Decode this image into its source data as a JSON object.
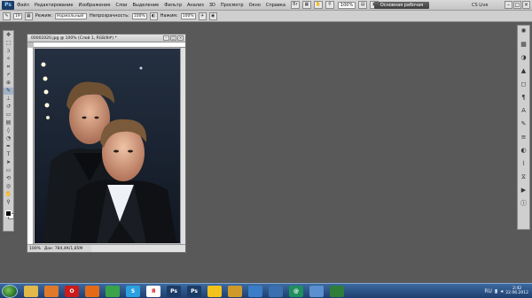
{
  "menubar": {
    "items": [
      "Файл",
      "Редактирование",
      "Изображение",
      "Слои",
      "Выделение",
      "Фильтр",
      "Анализ",
      "3D",
      "Просмотр",
      "Окно",
      "Справка"
    ],
    "zoom": "100%",
    "workspace_label": "Основная рабочая среда",
    "cslive_label": "CS Live"
  },
  "options_bar": {
    "brush_size": "19",
    "mode_label": "Режим:",
    "mode_value": "Нормальный",
    "opacity_label": "Непрозрачность:",
    "opacity_value": "100%",
    "flow_label": "Нажим:",
    "flow_value": "100%"
  },
  "document": {
    "title": "00002020.jpg @ 100% (Слой 1, RGB/8#) *",
    "zoom_status": "100%",
    "doc_size": "Док: 784,4К/1,85М",
    "image_icon": "photo-two-men"
  },
  "taskbar": {
    "apps": [
      {
        "icon": "folder-icon",
        "color": "#e1b84a",
        "label": ""
      },
      {
        "icon": "media-player-icon",
        "color": "#e07a2a",
        "label": ""
      },
      {
        "icon": "opera-icon",
        "color": "#cc1b1b",
        "label": "O"
      },
      {
        "icon": "firefox-icon",
        "color": "#e46a1a",
        "label": ""
      },
      {
        "icon": "icq-icon",
        "color": "#3aa34a",
        "label": ""
      },
      {
        "icon": "skype-icon",
        "color": "#2aa0e0",
        "label": "S"
      },
      {
        "icon": "yandex-icon",
        "color": "#ffffff",
        "label": "Я"
      },
      {
        "icon": "photoshop-icon",
        "color": "#1b3c66",
        "label": "Ps"
      },
      {
        "icon": "photoshop-icon-2",
        "color": "#1b3c66",
        "label": "Ps"
      },
      {
        "icon": "messenger-icon",
        "color": "#f3c21b",
        "label": ""
      },
      {
        "icon": "winamp-icon",
        "color": "#cf9a2a",
        "label": ""
      },
      {
        "icon": "paint-icon",
        "color": "#3b7dc8",
        "label": ""
      },
      {
        "icon": "chart-icon",
        "color": "#3a6fb0",
        "label": ""
      },
      {
        "icon": "browser-icon",
        "color": "#1f8f5f",
        "label": "@"
      },
      {
        "icon": "tool-icon",
        "color": "#5a8fd0",
        "label": ""
      },
      {
        "icon": "game-icon",
        "color": "#2e7d3a",
        "label": ""
      }
    ],
    "language": "RU",
    "time": "2:42",
    "date": "22.06.2012"
  }
}
